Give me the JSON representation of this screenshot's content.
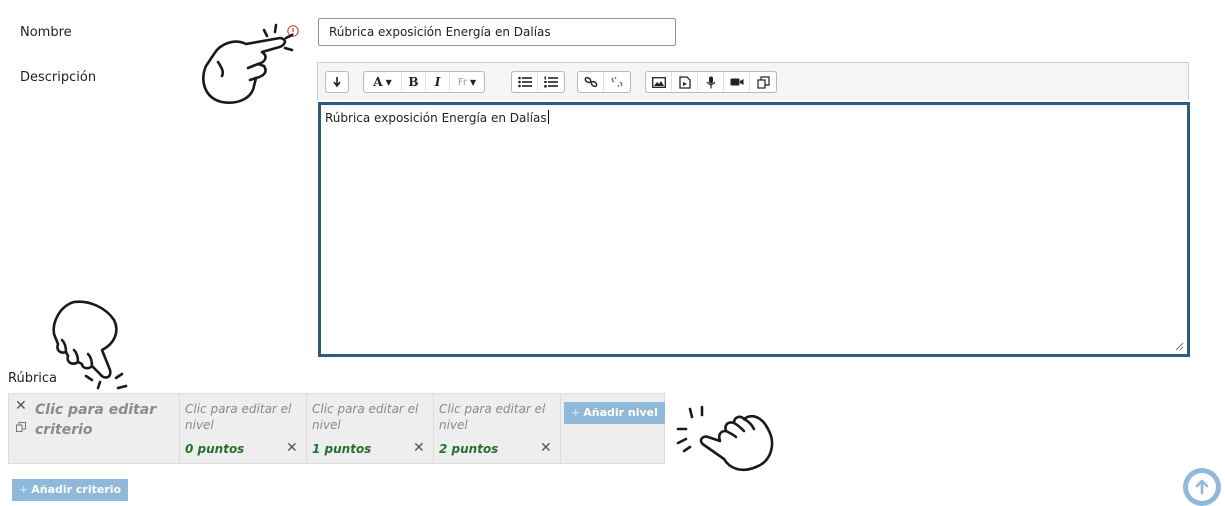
{
  "form": {
    "name_label": "Nombre",
    "name_value": "Rúbrica exposición Energía en Dalías",
    "description_label": "Descripción",
    "description_value": "Rúbrica exposición Energía en Dalías",
    "rubric_label": "Rúbrica"
  },
  "toolbar": {
    "groups": [
      [
        "collapse-icon"
      ],
      [
        "font-color-icon",
        "bold-icon",
        "italic-icon",
        "font-size-icon"
      ],
      [
        "unordered-list-icon",
        "ordered-list-icon"
      ],
      [
        "link-icon",
        "unlink-icon"
      ],
      [
        "image-icon",
        "media-icon",
        "record-audio-icon",
        "record-video-icon",
        "manage-files-icon"
      ]
    ],
    "bold_glyph": "B",
    "italic_glyph": "I",
    "font_color_glyph": "A",
    "font_size_glyph": "Fr"
  },
  "rubric": {
    "criterion_text": "Clic para editar criterio",
    "levels": [
      {
        "definition": "Clic para editar el nivel",
        "score": "0 puntos"
      },
      {
        "definition": "Clic para editar el nivel",
        "score": "1 puntos"
      },
      {
        "definition": "Clic para editar el nivel",
        "score": "2 puntos"
      }
    ],
    "add_level_label": "Añadir nivel",
    "add_criterion_label": "Añadir criterio"
  },
  "colors": {
    "editor_border": "#2f5b7e",
    "button_blue": "#8fb8d9",
    "score_green": "#2b6e2b",
    "required_red": "#c0392b"
  }
}
